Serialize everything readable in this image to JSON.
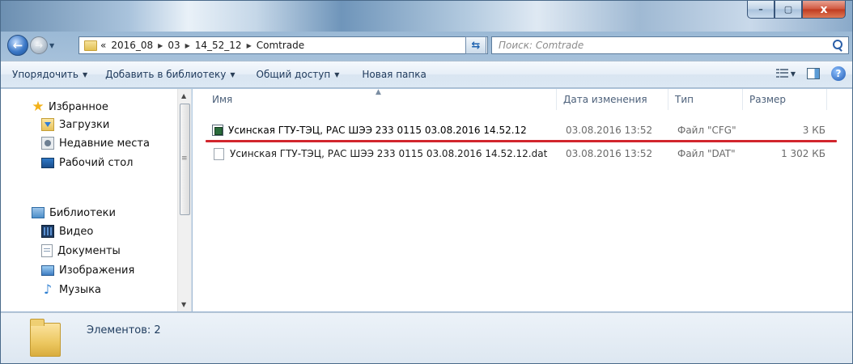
{
  "window": {
    "minimize_glyph": "–",
    "maximize_glyph": "▢",
    "close_glyph": "x"
  },
  "address": {
    "overflow": "«",
    "crumbs": [
      "2016_08",
      "03",
      "14_52_12",
      "Comtrade"
    ]
  },
  "search": {
    "placeholder": "Поиск: Comtrade"
  },
  "toolbar": {
    "organize": "Упорядочить",
    "add_to_library": "Добавить в библиотеку",
    "share": "Общий доступ",
    "new_folder": "Новая папка"
  },
  "sidebar": {
    "favorites": "Избранное",
    "downloads": "Загрузки",
    "recent": "Недавние места",
    "desktop": "Рабочий стол",
    "libraries": "Библиотеки",
    "video": "Видео",
    "documents": "Документы",
    "images": "Изображения",
    "music": "Музыка"
  },
  "columns": {
    "name": "Имя",
    "date": "Дата изменения",
    "type": "Тип",
    "size": "Размер"
  },
  "files": [
    {
      "name": "Усинская ГТУ-ТЭЦ, РАС ШЭЭ 233 0115 03.08.2016 14.52.12",
      "date": "03.08.2016 13:52",
      "type": "Файл \"CFG\"",
      "size": "3 КБ"
    },
    {
      "name": "Усинская ГТУ-ТЭЦ, РАС ШЭЭ 233 0115 03.08.2016 14.52.12.dat",
      "date": "03.08.2016 13:52",
      "type": "Файл \"DAT\"",
      "size": "1 302 КБ"
    }
  ],
  "status": {
    "count": "Элементов: 2"
  },
  "colors": {
    "highlight_underline": "#d2262d",
    "command_text": "#1e395b"
  }
}
